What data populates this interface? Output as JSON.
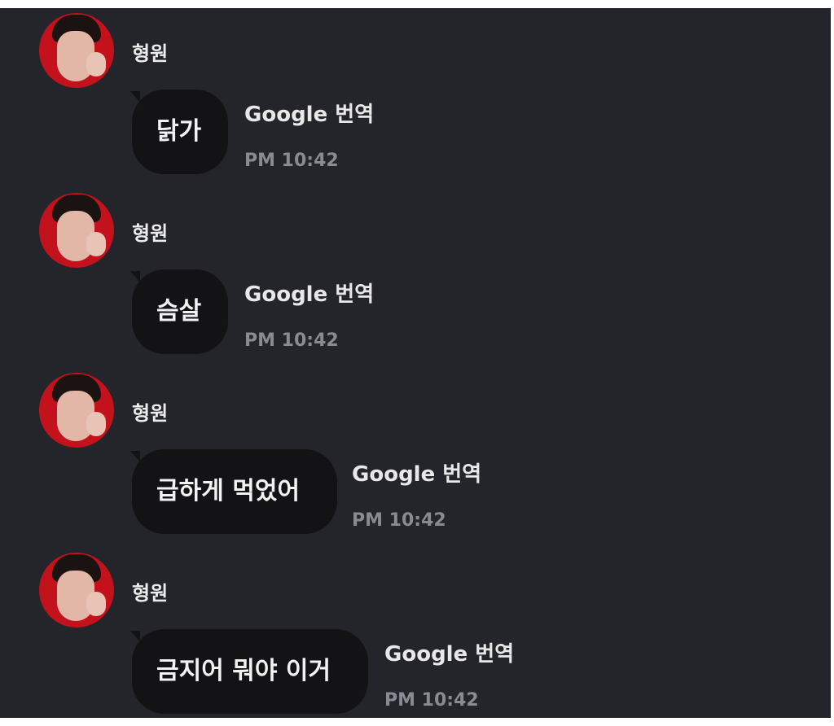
{
  "messages": [
    {
      "sender": "형원",
      "text": "닭가",
      "action": "Google 번역",
      "time": "PM 10:42"
    },
    {
      "sender": "형원",
      "text": "슴살",
      "action": "Google 번역",
      "time": "PM 10:42"
    },
    {
      "sender": "형원",
      "text": "급하게 먹었어",
      "action": "Google 번역",
      "time": "PM 10:42"
    },
    {
      "sender": "형원",
      "text": "금지어 뭐야 이거",
      "action": "Google 번역",
      "time": "PM 10:42"
    }
  ]
}
